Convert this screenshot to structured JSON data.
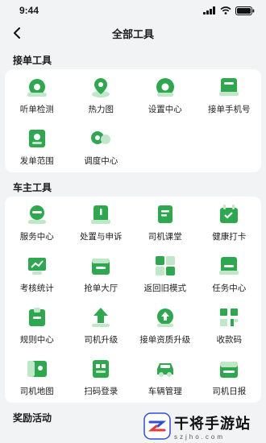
{
  "status": {
    "time": "9:44"
  },
  "nav": {
    "title": "全部工具"
  },
  "sections": [
    {
      "title": "接单工具",
      "items": [
        {
          "label": "听单检测",
          "icon": "listen-detect-icon"
        },
        {
          "label": "热力图",
          "icon": "heatmap-icon"
        },
        {
          "label": "设置中心",
          "icon": "settings-icon"
        },
        {
          "label": "接单手机号",
          "icon": "phone-number-icon"
        },
        {
          "label": "发单范围",
          "icon": "order-range-icon"
        },
        {
          "label": "调度中心",
          "icon": "dispatch-icon"
        }
      ]
    },
    {
      "title": "车主工具",
      "items": [
        {
          "label": "服务中心",
          "icon": "service-icon"
        },
        {
          "label": "处置与申诉",
          "icon": "appeal-icon"
        },
        {
          "label": "司机课堂",
          "icon": "classroom-icon"
        },
        {
          "label": "健康打卡",
          "icon": "health-checkin-icon"
        },
        {
          "label": "考核统计",
          "icon": "statistics-icon"
        },
        {
          "label": "抢单大厅",
          "icon": "order-hall-icon"
        },
        {
          "label": "返回旧模式",
          "icon": "old-mode-icon"
        },
        {
          "label": "任务中心",
          "icon": "task-icon"
        },
        {
          "label": "规则中心",
          "icon": "rules-icon"
        },
        {
          "label": "司机升级",
          "icon": "driver-upgrade-icon"
        },
        {
          "label": "接单资质升级",
          "icon": "qualification-upgrade-icon"
        },
        {
          "label": "收款码",
          "icon": "payment-code-icon"
        },
        {
          "label": "司机地图",
          "icon": "driver-map-icon"
        },
        {
          "label": "扫码登录",
          "icon": "scan-login-icon"
        },
        {
          "label": "车辆管理",
          "icon": "vehicle-icon"
        },
        {
          "label": "司机日报",
          "icon": "daily-report-icon"
        }
      ]
    },
    {
      "title": "奖励活动",
      "items": []
    }
  ],
  "watermark": {
    "title": "干将手游站",
    "subtitle": "szjho.com"
  },
  "colors": {
    "accent": "#2EA84E",
    "accent_light": "#BFE7C8",
    "background": "#F2F3F5"
  }
}
